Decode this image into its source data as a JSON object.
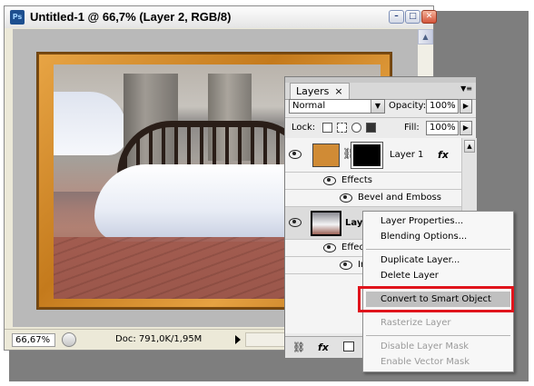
{
  "window": {
    "app_icon": "photoshop-icon",
    "title": "Untitled-1 @ 66,7% (Layer 2, RGB/8)",
    "buttons": {
      "minimize": "–",
      "maximize": "□",
      "close": "✕"
    }
  },
  "status": {
    "zoom": "66,67%",
    "doc": "Doc: 791,0K/1,95M"
  },
  "layers_panel": {
    "tab": "Layers",
    "tab_close": "×",
    "blend_mode": "Normal",
    "opacity_label": "Opacity:",
    "opacity_value": "100%",
    "lock_label": "Lock:",
    "fill_label": "Fill:",
    "fill_value": "100%",
    "layers": [
      {
        "name": "Layer 1",
        "effects_label": "Effects",
        "effect": "Bevel and Emboss",
        "fx": "fx"
      },
      {
        "name": "Lay",
        "effects_label": "Effect",
        "effect": "In"
      }
    ],
    "bottom_fx": "fx"
  },
  "context_menu": {
    "items": [
      {
        "label": "Layer Properties...",
        "enabled": true
      },
      {
        "label": "Blending Options...",
        "enabled": true
      },
      {
        "label": "Duplicate Layer...",
        "enabled": true
      },
      {
        "label": "Delete Layer",
        "enabled": true
      },
      {
        "label": "Convert to Smart Object",
        "enabled": true,
        "highlighted": true
      },
      {
        "label": "Rasterize Layer",
        "enabled": false
      },
      {
        "label": "Disable Layer Mask",
        "enabled": false
      },
      {
        "label": "Enable Vector Mask",
        "enabled": false
      }
    ],
    "highlight_color": "#e0141c"
  }
}
